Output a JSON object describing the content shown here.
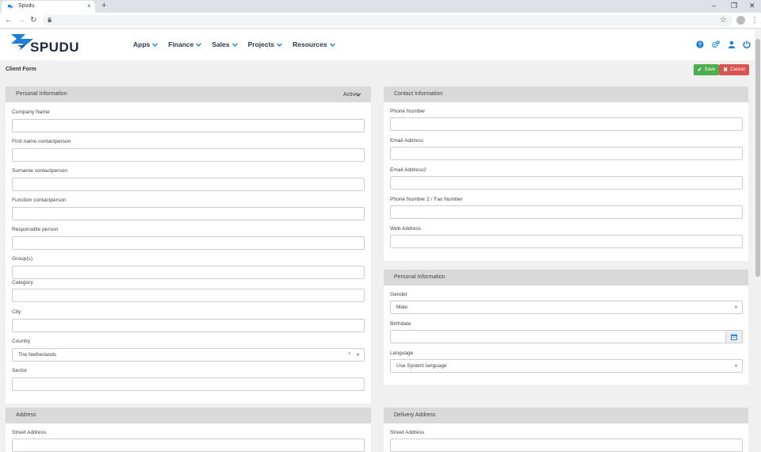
{
  "browser": {
    "tab_title": "Spudu",
    "tab_close": "×",
    "new_tab": "+",
    "minimize": "–",
    "restore": "❐",
    "close": "✕",
    "back": "←",
    "forward": "→",
    "reload": "↻",
    "star": "☆",
    "menu": "⋮"
  },
  "app": {
    "logo_text": "SPUDU",
    "nav": [
      {
        "label": "Apps"
      },
      {
        "label": "Finance"
      },
      {
        "label": "Sales"
      },
      {
        "label": "Projects"
      },
      {
        "label": "Resources"
      }
    ],
    "header_icons": [
      "help-icon",
      "settings-icon",
      "user-icon",
      "power-icon"
    ],
    "accent_color": "#1e7fd6"
  },
  "page": {
    "title": "Client Form",
    "save_label": "Save",
    "cancel_label": "Cancel",
    "save_color": "#4cae4c",
    "cancel_color": "#d9534f"
  },
  "personal": {
    "title": "Personal Information",
    "active_label": "Active",
    "fields": {
      "company_name": {
        "label": "Company Name",
        "value": ""
      },
      "first_name": {
        "label": "First name contactperson",
        "value": ""
      },
      "surname": {
        "label": "Surname contactperson",
        "value": ""
      },
      "function": {
        "label": "Function contactperson",
        "value": ""
      },
      "responsible": {
        "label": "Responsible person",
        "value": ""
      },
      "groups": {
        "label": "Group(s)",
        "value": ""
      },
      "category": {
        "label": "Category",
        "value": ""
      },
      "city": {
        "label": "City",
        "value": ""
      },
      "country": {
        "label": "Country",
        "value": "The Netherlands"
      },
      "sector": {
        "label": "Sector",
        "value": ""
      }
    }
  },
  "contact": {
    "title": "Contact Information",
    "fields": {
      "phone": {
        "label": "Phone Number",
        "value": ""
      },
      "email": {
        "label": "Email Address",
        "value": ""
      },
      "email2": {
        "label": "Email Address2",
        "value": ""
      },
      "phone2": {
        "label": "Phone Number 2 / Fax Number",
        "value": ""
      },
      "web": {
        "label": "Web Address",
        "value": ""
      }
    }
  },
  "personal2": {
    "title": "Personal Information",
    "fields": {
      "gender": {
        "label": "Gender",
        "value": "Male"
      },
      "birthdate": {
        "label": "Birthdate",
        "value": ""
      },
      "language": {
        "label": "Language",
        "value": "Use System language"
      }
    }
  },
  "address": {
    "title": "Address",
    "street_label": "Street Address"
  },
  "delivery": {
    "title": "Delivery Address",
    "street_label": "Street Address"
  }
}
